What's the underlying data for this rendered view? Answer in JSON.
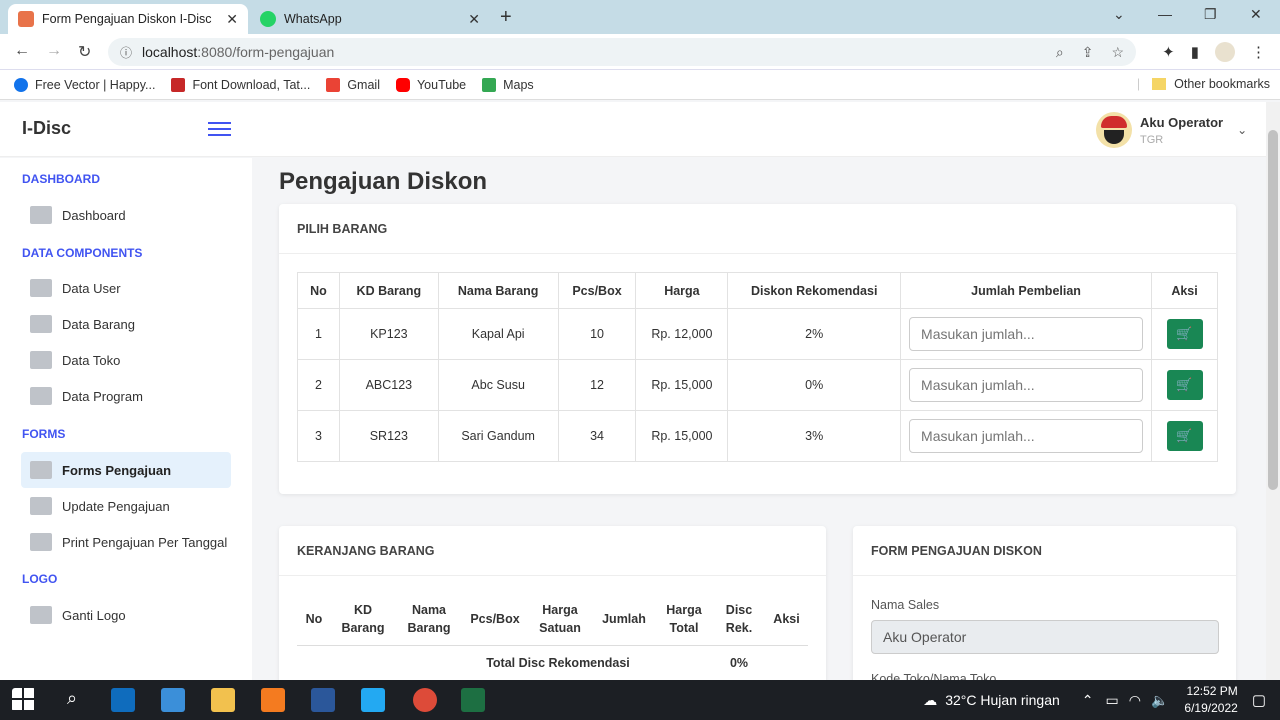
{
  "browser": {
    "tabs": [
      {
        "title": "Form Pengajuan Diskon I-Disc",
        "active": true
      },
      {
        "title": "WhatsApp",
        "active": false
      }
    ],
    "url_host": "localhost",
    "url_path": ":8080/form-pengajuan",
    "bookmarks": [
      "Free Vector | Happy...",
      "Font Download, Tat...",
      "Gmail",
      "YouTube",
      "Maps"
    ],
    "other_bookmarks": "Other bookmarks"
  },
  "app": {
    "brand": "I-Disc",
    "user": {
      "name": "Aku Operator",
      "role": "TGR"
    }
  },
  "sidebar": {
    "sections": [
      {
        "title": "DASHBOARD",
        "items": [
          {
            "label": "Dashboard",
            "icon": "chart-line-icon"
          }
        ]
      },
      {
        "title": "DATA COMPONENTS",
        "items": [
          {
            "label": "Data User",
            "icon": "id-card-icon"
          },
          {
            "label": "Data Barang",
            "icon": "wallet-icon"
          },
          {
            "label": "Data Toko",
            "icon": "shop-icon"
          },
          {
            "label": "Data Program",
            "icon": "book-icon"
          }
        ]
      },
      {
        "title": "FORMS",
        "items": [
          {
            "label": "Forms Pengajuan",
            "icon": "form-icon",
            "active": true
          },
          {
            "label": "Update Pengajuan",
            "icon": "pencil-icon"
          },
          {
            "label": "Print Pengajuan Per Tanggal",
            "icon": "printer-icon"
          }
        ]
      },
      {
        "title": "LOGO",
        "items": [
          {
            "label": "Ganti Logo",
            "icon": "image-icon"
          }
        ]
      }
    ]
  },
  "page": {
    "title": "Pengajuan Diskon",
    "pilih_barang": {
      "header": "PILIH BARANG",
      "columns": [
        "No",
        "KD Barang",
        "Nama Barang",
        "Pcs/Box",
        "Harga",
        "Diskon Rekomendasi",
        "Jumlah Pembelian",
        "Aksi"
      ],
      "qty_placeholder": "Masukan jumlah...",
      "rows": [
        {
          "no": "1",
          "kd": "KP123",
          "nama": "Kapal Api",
          "pcs": "10",
          "harga": "Rp. 12,000",
          "diskon": "2%"
        },
        {
          "no": "2",
          "kd": "ABC123",
          "nama": "Abc Susu",
          "pcs": "12",
          "harga": "Rp. 15,000",
          "diskon": "0%"
        },
        {
          "no": "3",
          "kd": "SR123",
          "nama": "Sari Gandum",
          "pcs": "34",
          "harga": "Rp. 15,000",
          "diskon": "3%"
        }
      ]
    },
    "keranjang": {
      "header": "KERANJANG BARANG",
      "columns": [
        "No",
        "KD Barang",
        "Nama Barang",
        "Pcs/Box",
        "Harga Satuan",
        "Jumlah",
        "Harga Total",
        "Disc Rek.",
        "Aksi"
      ],
      "total_label": "Total Disc Rekomendasi",
      "total_value": "0%"
    },
    "form_pengajuan": {
      "header": "FORM PENGAJUAN DISKON",
      "nama_sales_label": "Nama Sales",
      "nama_sales_value": "Aku Operator",
      "kode_toko_label": "Kode Toko/Nama Toko"
    }
  },
  "taskbar": {
    "weather": "32°C  Hujan ringan",
    "time": "12:52 PM",
    "date": "6/19/2022"
  }
}
